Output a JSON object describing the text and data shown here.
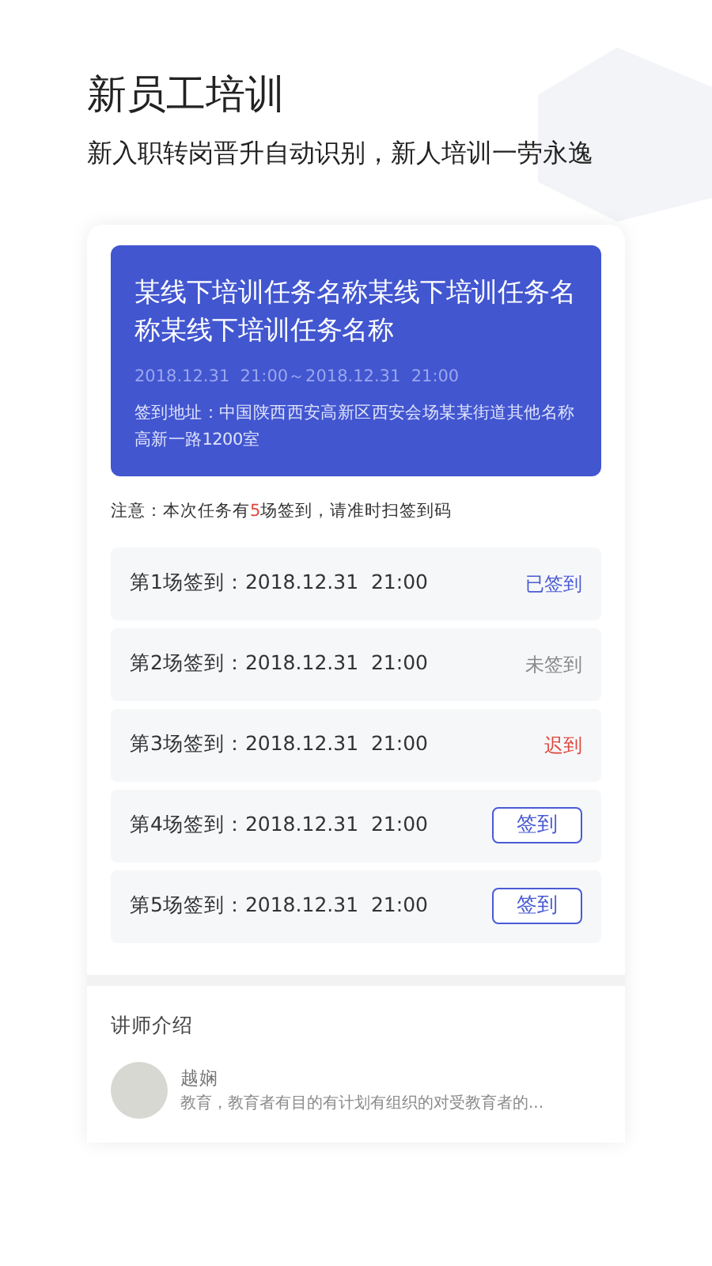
{
  "header": {
    "title": "新员工培训",
    "subtitle": "新入职转岗晋升自动识别，新人培训一劳永逸"
  },
  "task": {
    "title": "某线下培训任务名称某线下培训任务名称某线下培训任务名称",
    "time": "2018.12.31  21:00～2018.12.31  21:00",
    "address": "签到地址：中国陕西西安高新区西安会场某某街道其他名称高新一路1200室"
  },
  "notice": {
    "before": "注意：本次任务有",
    "count": "5",
    "after": "场签到，请准时扫签到码"
  },
  "sessions": [
    {
      "label": "第1场签到：2018.12.31  21:00",
      "kind": "signed",
      "status": "已签到"
    },
    {
      "label": "第2场签到：2018.12.31  21:00",
      "kind": "unsigned",
      "status": "未签到"
    },
    {
      "label": "第3场签到：2018.12.31  21:00",
      "kind": "late",
      "status": "迟到"
    },
    {
      "label": "第4场签到：2018.12.31  21:00",
      "kind": "button",
      "status": "签到"
    },
    {
      "label": "第5场签到：2018.12.31  21:00",
      "kind": "button",
      "status": "签到"
    }
  ],
  "teacher": {
    "heading": "讲师介绍",
    "name": "越娴",
    "bio": "教育，教育者有目的有计划有组织的对受教育者的..."
  }
}
